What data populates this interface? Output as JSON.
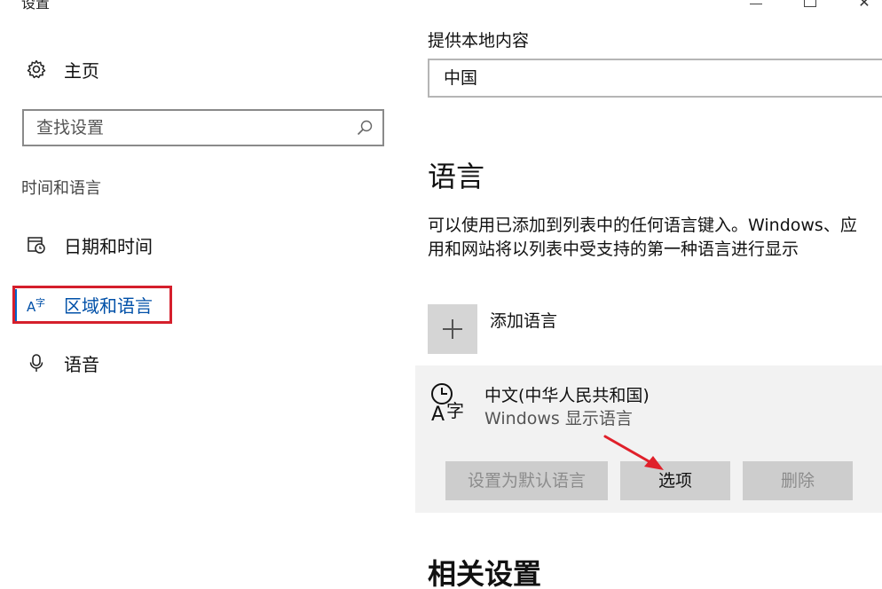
{
  "window": {
    "title": "设置"
  },
  "sidebar": {
    "home_label": "主页",
    "search_placeholder": "查找设置",
    "section_header": "时间和语言",
    "items": [
      {
        "label": "日期和时间"
      },
      {
        "label": "区域和语言",
        "selected": true
      },
      {
        "label": "语音"
      }
    ]
  },
  "main": {
    "region_label": "提供本地内容",
    "region_value": "中国",
    "language_heading": "语言",
    "language_description": "可以使用已添加到列表中的任何语言键入。Windows、应用和网站将以列表中受支持的第一种语言进行显示",
    "add_language_label": "添加语言",
    "language_entry": {
      "name": "中文(中华人民共和国)",
      "sub": "Windows 显示语言",
      "buttons": {
        "set_default": "设置为默认语言",
        "options": "选项",
        "remove": "删除"
      }
    },
    "related_heading": "相关设置"
  },
  "colors": {
    "accent": "#0063c9",
    "highlight": "#d51f2c",
    "arrow": "#e0202a"
  }
}
